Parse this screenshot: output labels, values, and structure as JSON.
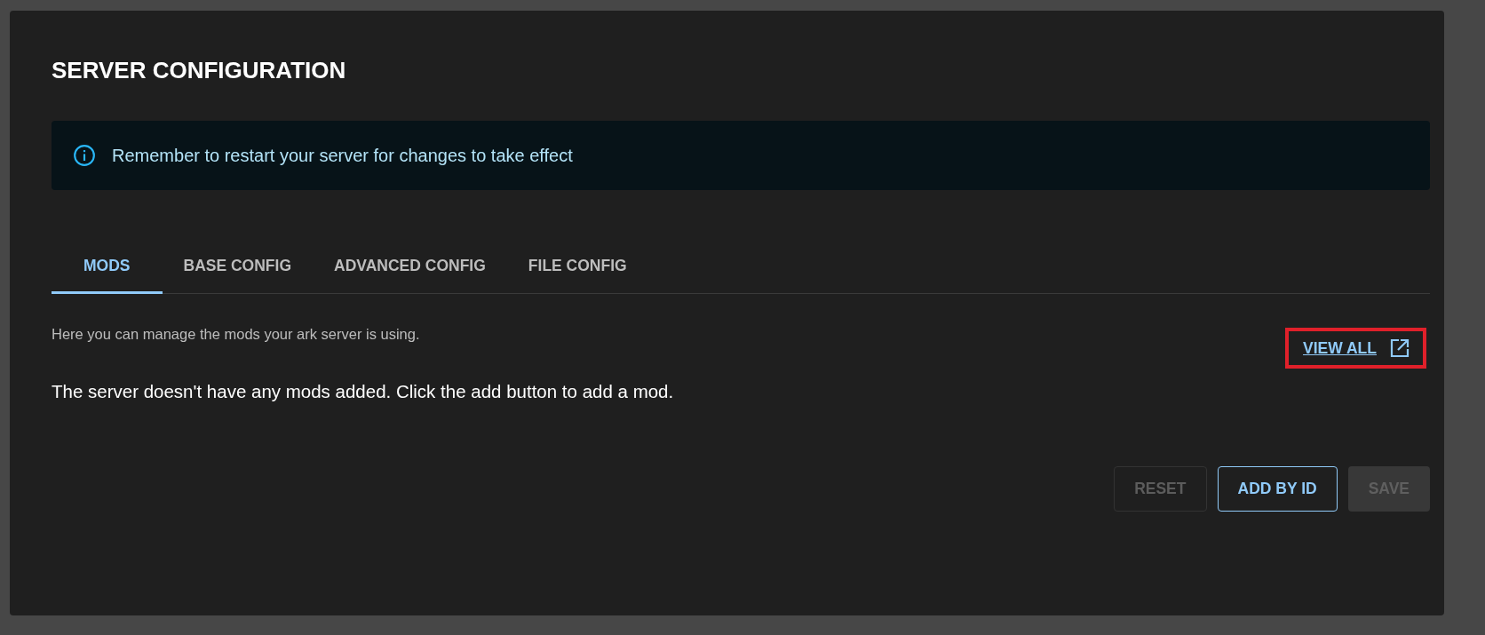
{
  "title": "SERVER CONFIGURATION",
  "alert": {
    "kind": "info",
    "message": "Remember to restart your server for changes to take effect"
  },
  "tabs": [
    {
      "label": "MODS",
      "selected": true
    },
    {
      "label": "BASE CONFIG",
      "selected": false
    },
    {
      "label": "ADVANCED CONFIG",
      "selected": false
    },
    {
      "label": "FILE CONFIG",
      "selected": false
    }
  ],
  "description": "Here you can manage the mods your ark server is using.",
  "view_all_link": {
    "label": "VIEW ALL",
    "highlighted": true
  },
  "empty_message": "The server doesn't have any mods added. Click the add button to add a mod.",
  "buttons": [
    {
      "label": "RESET",
      "kind": "outlined",
      "disabled": true
    },
    {
      "label": "ADD BY ID",
      "kind": "outlined",
      "disabled": false
    },
    {
      "label": "SAVE",
      "kind": "contained",
      "disabled": true
    }
  ]
}
